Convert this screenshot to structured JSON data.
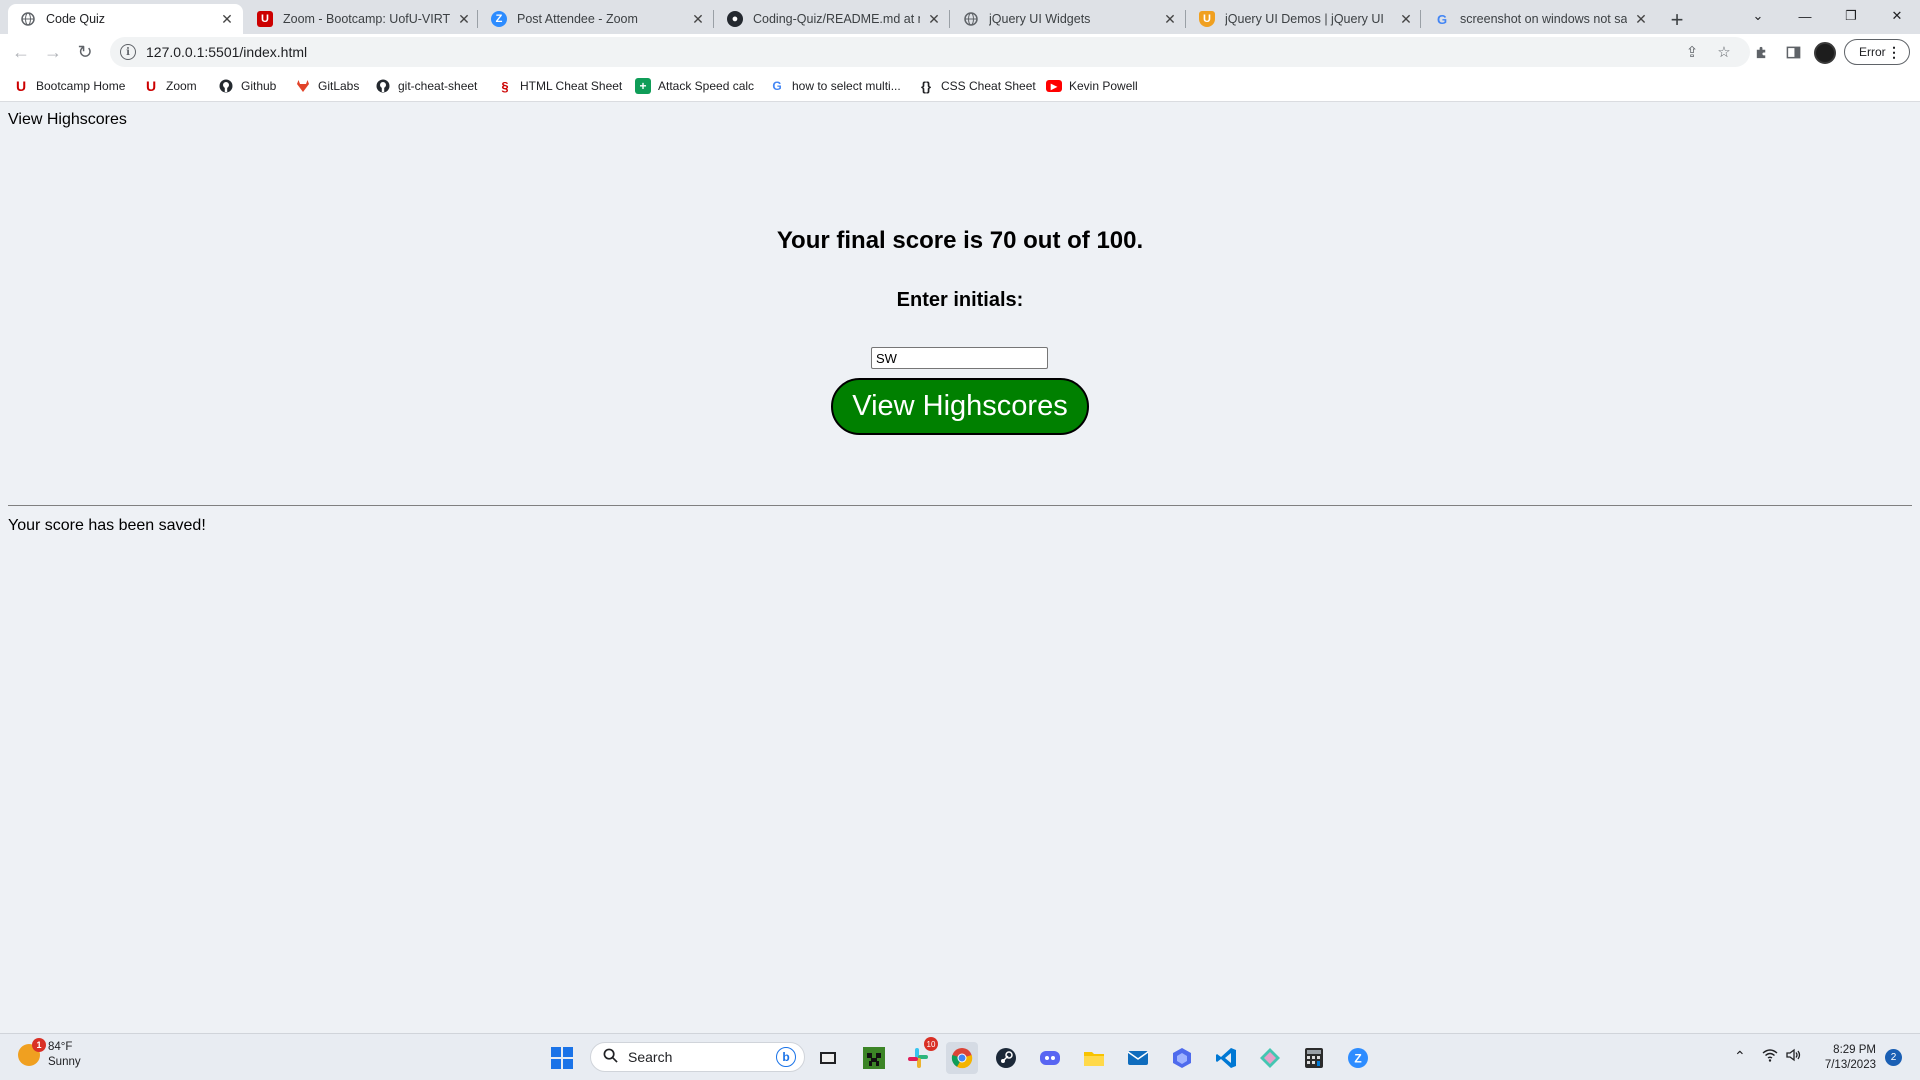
{
  "browser": {
    "tabs": [
      {
        "title": "Code Quiz",
        "favicon": "globe-icon",
        "color": "#5f6368"
      },
      {
        "title": "Zoom - Bootcamp: UofU-VIRT-F",
        "favicon": "utah-u-icon",
        "color": "#cc0000"
      },
      {
        "title": "Post Attendee - Zoom",
        "favicon": "zoom-icon",
        "color": "#2d8cff"
      },
      {
        "title": "Coding-Quiz/README.md at ma",
        "favicon": "github-icon",
        "color": "#24292f"
      },
      {
        "title": "jQuery UI Widgets",
        "favicon": "globe-icon",
        "color": "#5f6368"
      },
      {
        "title": "jQuery UI Demos | jQuery UI",
        "favicon": "shield-icon",
        "color": "#f0a020"
      },
      {
        "title": "screenshot on windows not savi",
        "favicon": "google-icon",
        "color": "#4285f4"
      }
    ],
    "url": "127.0.0.1:5501/index.html",
    "profile_button": "Error"
  },
  "bookmarks": [
    {
      "label": "Bootcamp Home",
      "icon": "utah-u-icon",
      "color": "#cc0000"
    },
    {
      "label": "Zoom",
      "icon": "utah-u-icon",
      "color": "#cc0000"
    },
    {
      "label": "Github",
      "icon": "github-icon",
      "color": "#24292f"
    },
    {
      "label": "GitLabs",
      "icon": "gitlab-icon",
      "color": "#e24329"
    },
    {
      "label": "git-cheat-sheet",
      "icon": "github-icon",
      "color": "#24292f"
    },
    {
      "label": "HTML Cheat Sheet",
      "icon": "html-icon",
      "color": "#cc0000"
    },
    {
      "label": "Attack Speed calc",
      "icon": "sheets-icon",
      "color": "#0f9d58"
    },
    {
      "label": "how to select multi...",
      "icon": "google-icon",
      "color": "#4285f4"
    },
    {
      "label": "CSS Cheat Sheet",
      "icon": "braces-icon",
      "color": "#202124"
    },
    {
      "label": "Kevin Powell",
      "icon": "youtube-icon",
      "color": "#ff0000"
    }
  ],
  "page": {
    "nav_link": "View Highscores",
    "final_score": "Your final score is 70 out of 100.",
    "initials_label": "Enter initials:",
    "initials_value": "SW",
    "submit_button": "View Highscores",
    "saved_message": "Your score has been saved!",
    "accent_color": "#008000"
  },
  "taskbar": {
    "weather_temp": "84°F",
    "weather_desc": "Sunny",
    "weather_badge": "1",
    "search_placeholder": "Search",
    "slack_badge": "10",
    "time": "8:29 PM",
    "date": "7/13/2023",
    "notification_count": "2"
  }
}
